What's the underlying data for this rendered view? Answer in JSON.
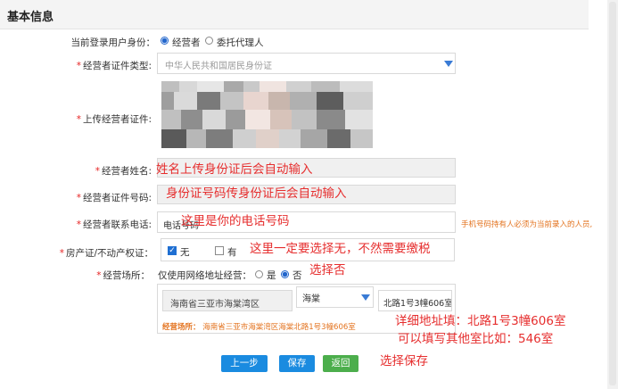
{
  "section_title": "基本信息",
  "identity": {
    "label": "当前登录用户身份：",
    "options": [
      "经营者",
      "委托代理人"
    ],
    "selected": "经营者"
  },
  "cert_type": {
    "label": "经营者证件类型:",
    "value": "中华人民共和国居民身份证"
  },
  "upload": {
    "label": "上传经营者证件:"
  },
  "name": {
    "label": "经营者姓名:",
    "annotation": "姓名上传身份证后会自动输入"
  },
  "cert_no": {
    "label": "经营者证件号码:",
    "annotation": "身份证号码传身份证后会自动输入"
  },
  "phone": {
    "label": "经营者联系电话:",
    "value": "电话号码",
    "annotation": "这里是你的电话号码",
    "hint": "手机号码持有人必须为当前录入的人员,"
  },
  "property": {
    "label": "房产证/不动产权证：",
    "options": [
      "无",
      "有"
    ],
    "checked": "无",
    "annotation": "这里一定要选择无，不然需要缴税"
  },
  "premises": {
    "label": "经营场所：",
    "online_question": "仅使用网络地址经营：",
    "options": [
      "是",
      "否"
    ],
    "selected": "否",
    "annotation": "选择否",
    "region": "海南省三亚市海棠湾区",
    "district": "海棠",
    "detail": "北路1号3幢606室",
    "summary_label": "经营场所：",
    "summary_value": "海南省三亚市海棠湾区海棠北路1号3幢606室",
    "annotation2": "详细地址填：北路1号3幢606室",
    "annotation3": "可以填写其他室比如：546室"
  },
  "buttons": {
    "prev": "上一步",
    "save": "保存",
    "back": "返回",
    "annotation": "选择保存"
  },
  "colors": {
    "accent": "#2266cc",
    "annotation_red": "#e62e2e",
    "button_blue": "#1a8be0",
    "button_green": "#4cae4c",
    "hint_orange": "#e3731f"
  }
}
